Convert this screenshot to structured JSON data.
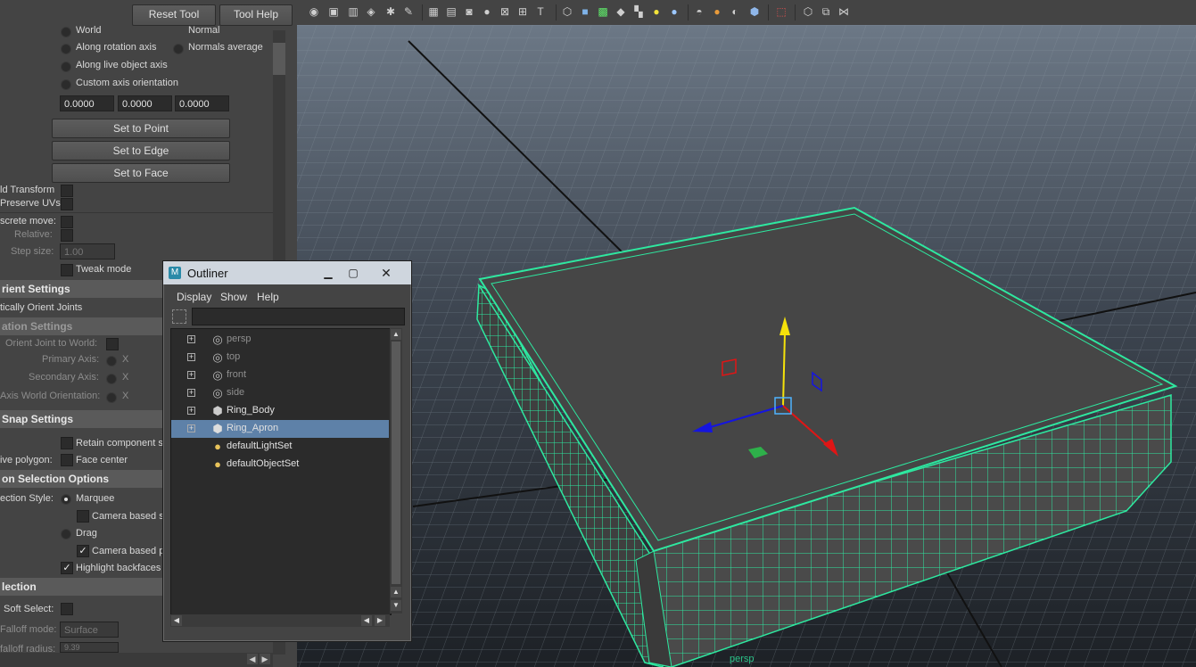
{
  "left_panel": {
    "reset_tool": "Reset Tool",
    "tool_help": "Tool Help",
    "axis_options": {
      "world": "World",
      "normal": "Normal",
      "along_rotation_axis": "Along rotation axis",
      "normals_average": "Normals average",
      "along_live_object_axis": "Along live object axis",
      "custom_axis_orientation": "Custom axis orientation"
    },
    "custom_values": [
      "0.0000",
      "0.0000",
      "0.0000"
    ],
    "set_to_point": "Set to Point",
    "set_to_edge": "Set to Edge",
    "set_to_face": "Set to Face",
    "hold_transform": "ld Transform",
    "preserve_uvs": "Preserve UVs",
    "discrete_move": "screte move:",
    "relative": "Relative:",
    "step_size_label": "Step size:",
    "step_size_value": "1.00",
    "tweak_mode": "Tweak mode",
    "joint_orient_settings": "rient Settings",
    "auto_orient_joints": "tically Orient Joints",
    "rotation_settings": "ation Settings",
    "orient_joint_to_world": "Orient Joint to World:",
    "primary_axis": "Primary Axis:",
    "secondary_axis": "Secondary Axis:",
    "axis_world_orientation": "Axis World Orientation:",
    "x": "X",
    "snap_settings": "Snap Settings",
    "retain_component_spacing": "Retain component s",
    "live_polygon": "ive polygon:",
    "face_center": "Face center",
    "selection_options": "on Selection Options",
    "selection_style": "ection Style:",
    "marquee": "Marquee",
    "camera_based_s": "Camera based s",
    "drag": "Drag",
    "camera_based_p": "Camera based p",
    "highlight_backfaces": "Highlight backfaces",
    "soft_selection": "lection",
    "soft_select": "Soft Select:",
    "falloff_mode": "Falloff mode:",
    "falloff_mode_value": "Surface",
    "falloff_radius": "falloff radius:",
    "falloff_radius_value": "9.39"
  },
  "outliner": {
    "title": "Outliner",
    "menu": [
      "Display",
      "Show",
      "Help"
    ],
    "search_placeholder": "",
    "items": [
      {
        "label": "persp",
        "icon": "camera-icon",
        "dim": true,
        "expander": "+"
      },
      {
        "label": "top",
        "icon": "camera-icon",
        "dim": true,
        "expander": "+"
      },
      {
        "label": "front",
        "icon": "camera-icon",
        "dim": true,
        "expander": "+"
      },
      {
        "label": "side",
        "icon": "camera-icon",
        "dim": true,
        "expander": "+"
      },
      {
        "label": "Ring_Body",
        "icon": "mesh-icon",
        "dim": false,
        "expander": "+"
      },
      {
        "label": "Ring_Apron",
        "icon": "mesh-icon",
        "dim": false,
        "expander": "+",
        "selected": true
      },
      {
        "label": "defaultLightSet",
        "icon": "set-icon",
        "dim": false,
        "expander": ""
      },
      {
        "label": "defaultObjectSet",
        "icon": "set-icon",
        "dim": false,
        "expander": ""
      }
    ]
  },
  "viewport": {
    "camera_label": "persp"
  },
  "colors": {
    "wire": "#2ee8a0",
    "selected_row": "#5e81a8",
    "y_axis": "#f5e20a",
    "x_axis": "#e01515",
    "z_axis": "#1515e0"
  }
}
